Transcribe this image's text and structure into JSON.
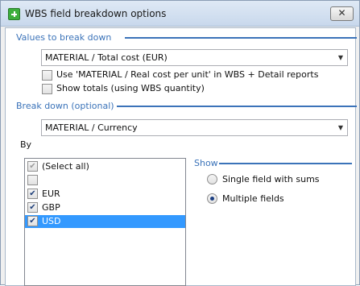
{
  "window": {
    "title": "WBS field breakdown options",
    "close_symbol": "✕"
  },
  "values_section": {
    "heading": "Values to break down",
    "combo_value": "MATERIAL / Total cost (EUR)",
    "options": [
      {
        "label": "Use 'MATERIAL / Real cost per unit' in WBS + Detail reports",
        "checked": false
      },
      {
        "label": "Show totals (using WBS quantity)",
        "checked": false
      }
    ]
  },
  "breakdown_section": {
    "heading": "Break down (optional)",
    "combo_value": "MATERIAL / Currency",
    "by_label": "By",
    "list_items": [
      {
        "label": "(Select all)",
        "checked": true,
        "greyed": true,
        "selected": false
      },
      {
        "label": "",
        "checked": false,
        "greyed": false,
        "selected": false
      },
      {
        "label": "EUR",
        "checked": true,
        "greyed": false,
        "selected": false
      },
      {
        "label": "GBP",
        "checked": true,
        "greyed": false,
        "selected": false
      },
      {
        "label": "USD",
        "checked": true,
        "greyed": false,
        "selected": true
      }
    ]
  },
  "show_section": {
    "heading": "Show",
    "options": [
      {
        "label": "Single field with sums",
        "checked": false
      },
      {
        "label": "Multiple fields",
        "checked": true
      }
    ]
  },
  "colors": {
    "accent": "#3b73b9",
    "selection": "#3399ff"
  },
  "icons": {
    "app": "green-plus-icon",
    "close": "close-icon",
    "dropdown": "chevron-down-icon",
    "check": "checkmark-icon"
  }
}
